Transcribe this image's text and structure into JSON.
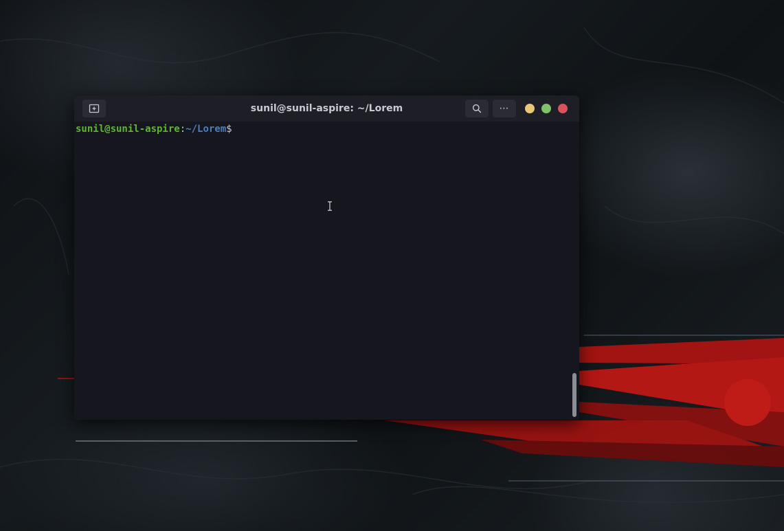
{
  "window": {
    "title": "sunil@sunil-aspire: ~/Lorem"
  },
  "toolbar": {
    "new_tab_icon": "new-tab-icon",
    "search_icon": "search-icon",
    "menu_icon": "more-horizontal-icon",
    "menu_label": "⋯"
  },
  "window_controls": {
    "minimize_color": "#e8c878",
    "maximize_color": "#7fc26a",
    "close_color": "#d9535e"
  },
  "prompt": {
    "user_host": "sunil@sunil-aspire",
    "separator": ":",
    "path": "~/Lorem",
    "symbol": "$",
    "user_host_color": "#5fb532",
    "path_color": "#4f7fb8",
    "symbol_color": "#c9cad0"
  }
}
